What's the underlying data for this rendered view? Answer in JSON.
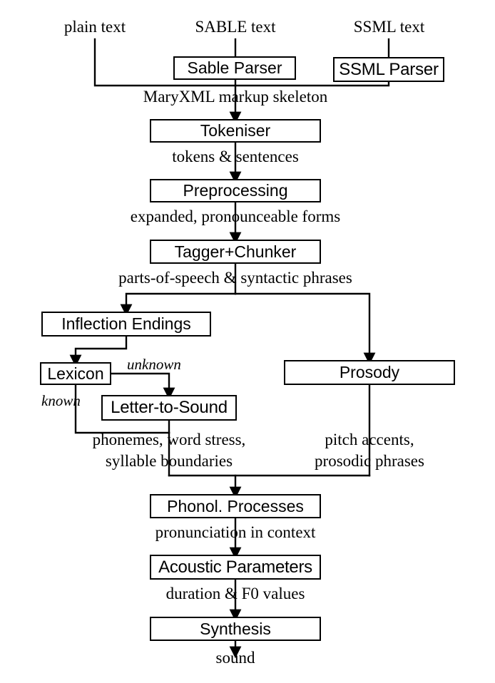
{
  "diagram": {
    "title": "MARY TTS processing pipeline",
    "type": "flowchart",
    "stroke_color": "#000000",
    "background_color": "#ffffff",
    "modules": [
      {
        "id": "sable_parser",
        "label": "Sable Parser"
      },
      {
        "id": "ssml_parser",
        "label": "SSML Parser"
      },
      {
        "id": "tokeniser",
        "label": "Tokeniser"
      },
      {
        "id": "preprocessing",
        "label": "Preprocessing"
      },
      {
        "id": "tagger_chunker",
        "label": "Tagger+Chunker"
      },
      {
        "id": "inflection_endings",
        "label": "Inflection Endings"
      },
      {
        "id": "lexicon",
        "label": "Lexicon"
      },
      {
        "id": "letter_to_sound",
        "label": "Letter-to-Sound"
      },
      {
        "id": "prosody",
        "label": "Prosody"
      },
      {
        "id": "phonol_processes",
        "label": "Phonol. Processes"
      },
      {
        "id": "acoustic_parameters",
        "label": "Acoustic Parameters"
      },
      {
        "id": "synthesis",
        "label": "Synthesis"
      }
    ],
    "inputs": {
      "plain_text": "plain text",
      "sable_text": "SABLE text",
      "ssml_text": "SSML text"
    },
    "flow_labels": {
      "maryxml": "MaryXML markup skeleton",
      "tokens_sentences": "tokens & sentences",
      "expanded_forms": "expanded, pronounceable forms",
      "pos_phrases": "parts-of-speech & syntactic phrases",
      "unknown": "unknown",
      "known": "known",
      "phonemes_line1": "phonemes, word stress,",
      "phonemes_line2": "syllable boundaries",
      "prosodic_line1": "pitch accents,",
      "prosodic_line2": "prosodic phrases",
      "pronunciation_in_context": "pronunciation in context",
      "duration_f0": "duration & F0 values",
      "sound": "sound"
    }
  }
}
